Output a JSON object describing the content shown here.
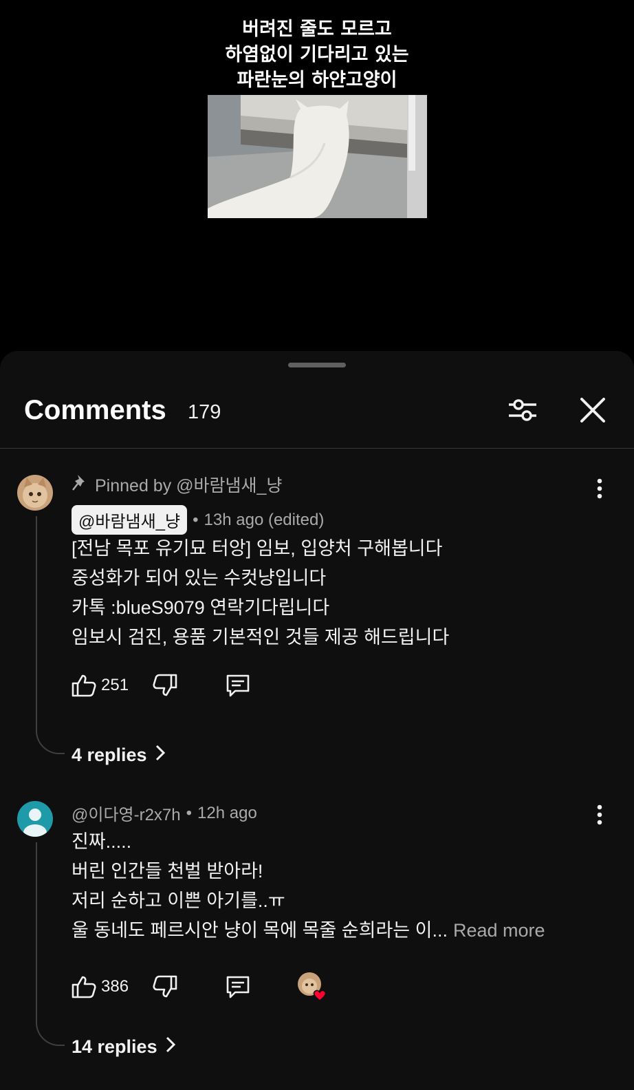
{
  "video": {
    "caption": "버려진 줄도 모르고\n하염없이 기다리고 있는\n파란눈의 하얀고양이"
  },
  "header": {
    "title": "Comments",
    "count": "179",
    "filter_icon": "sliders-icon",
    "close_icon": "close-icon"
  },
  "comments": [
    {
      "pinned_text": "Pinned by @바람냄새_냥",
      "author": "@바람냄새_냥",
      "separator": "•",
      "time": "13h ago (edited)",
      "lines": [
        "[전남 목포 유기묘 터앙] 임보, 입양처 구해봅니다",
        "중성화가 되어 있는 수컷냥입니다",
        "카톡 :blueS9079 연락기다립니다",
        "임보시 검진, 용품 기본적인 것들 제공 해드립니다"
      ],
      "likes": "251",
      "replies": "4 replies"
    },
    {
      "author": "@이다영-r2x7h",
      "separator": "•",
      "time": "12h ago",
      "lines": [
        "진짜.....",
        "버린 인간들 천벌 받아라!",
        "저리 순하고 이쁜 아기를..ㅠ",
        "울 동네도 페르시안 냥이 목에 목줄  순희라는 이..."
      ],
      "read_more": "Read more",
      "likes": "386",
      "replies": "14 replies"
    }
  ],
  "colors": {
    "sheet_bg": "#0f0f0f",
    "text_primary": "#f1f1f1",
    "text_secondary": "#aaaaaa",
    "heart": "#ff0033",
    "avatar_teal": "#1e9aa8"
  }
}
